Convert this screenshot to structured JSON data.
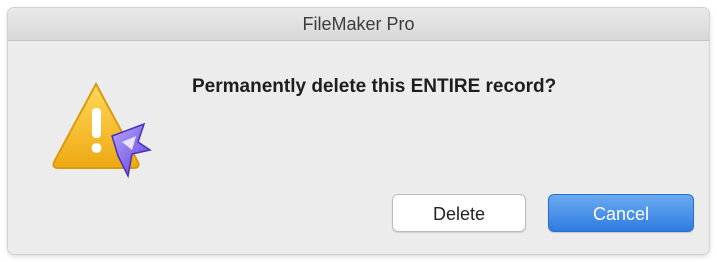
{
  "window": {
    "title": "FileMaker Pro"
  },
  "dialog": {
    "icon": "warning-triangle-icon",
    "message": "Permanently delete this ENTIRE record?"
  },
  "buttons": {
    "delete_label": "Delete",
    "cancel_label": "Cancel"
  },
  "colors": {
    "accent": "#3b84e6",
    "warning": "#f1b21e"
  }
}
